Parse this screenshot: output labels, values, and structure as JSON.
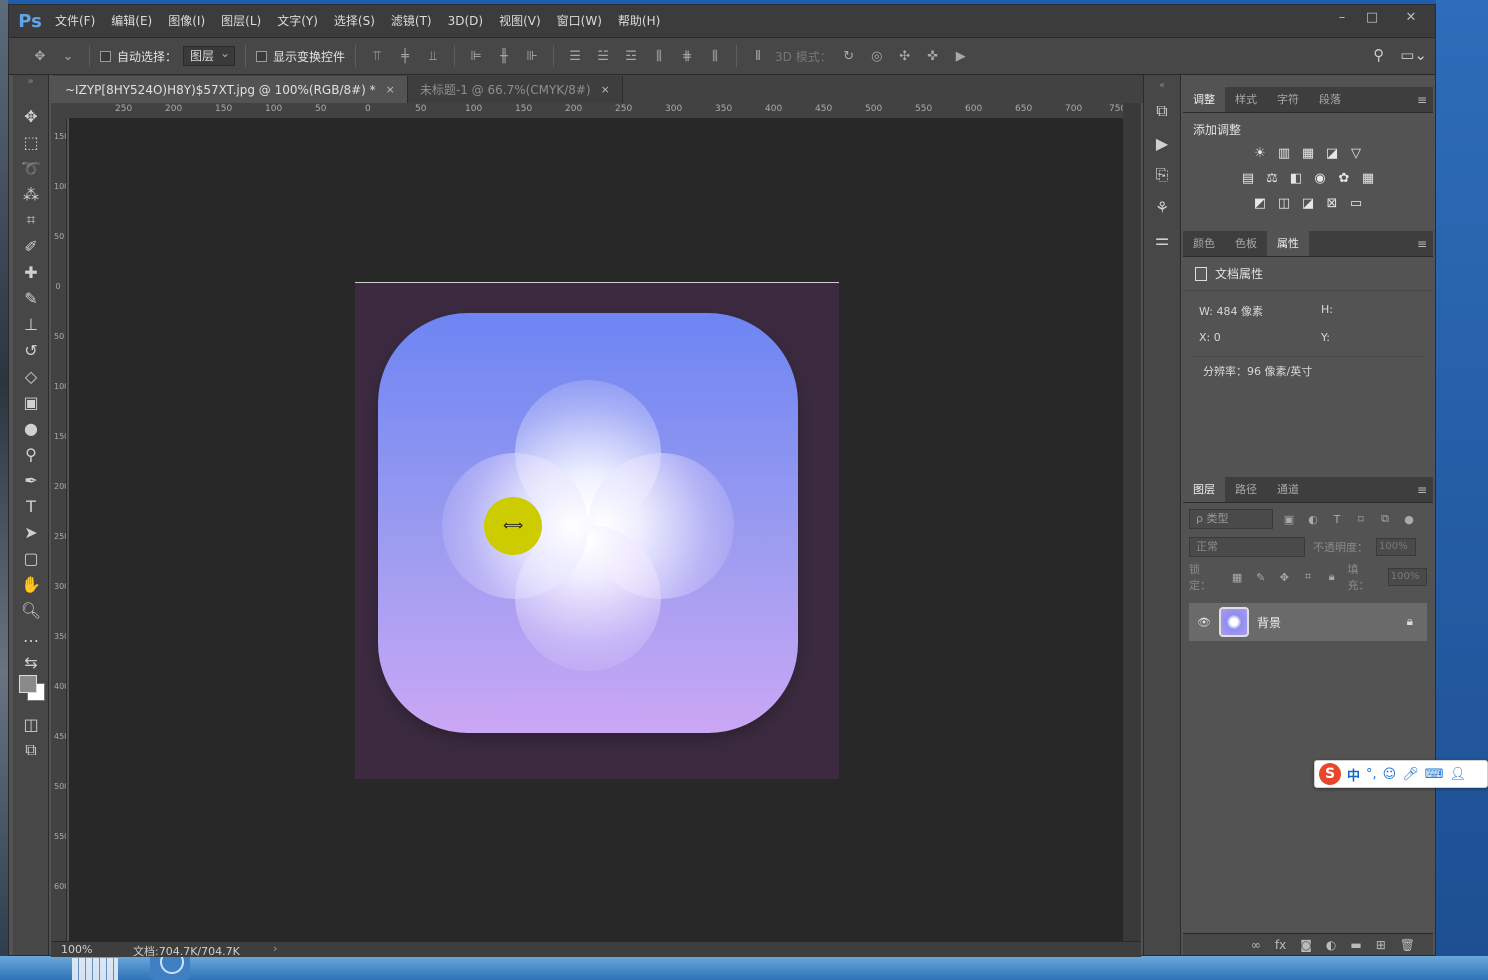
{
  "menubar": {
    "logo": "Ps",
    "items": [
      "文件(F)",
      "编辑(E)",
      "图像(I)",
      "图层(L)",
      "文字(Y)",
      "选择(S)",
      "滤镜(T)",
      "3D(D)",
      "视图(V)",
      "窗口(W)",
      "帮助(H)"
    ],
    "window_controls": [
      "–",
      "□",
      "✕"
    ]
  },
  "options": {
    "auto_select_label": "自动选择：",
    "auto_select_value": "图层",
    "show_transform_label": "显示变换控件",
    "mode_3d_label": "3D 模式："
  },
  "tabs": [
    {
      "label": "~IZYP[8HY524O)H8Y)$57XT.jpg @ 100%(RGB/8#) *",
      "close": "×"
    },
    {
      "label": "未标题-1 @ 66.7%(CMYK/8#)",
      "close": "×"
    }
  ],
  "ruler": {
    "top_labels": [
      "250",
      "200",
      "150",
      "100",
      "50",
      "0",
      "50",
      "100",
      "150",
      "200",
      "250",
      "300",
      "350",
      "400",
      "450",
      "500",
      "550",
      "600",
      "650",
      "700",
      "750"
    ],
    "left_labels": [
      "150",
      "100",
      "50",
      "0",
      "50",
      "100",
      "150",
      "200",
      "250",
      "300",
      "350",
      "400",
      "450",
      "500",
      "550",
      "600"
    ]
  },
  "cursor_glyph": "⟺",
  "status": {
    "zoom": "100%",
    "doc": "文档:704.7K/704.7K",
    "arrow": "›"
  },
  "adjust_panel": {
    "tabs": [
      "调整",
      "样式",
      "字符",
      "段落"
    ],
    "title": "添加调整",
    "icon_rows": [
      [
        "☀",
        "▥",
        "▦",
        "◪",
        "▽"
      ],
      [
        "▤",
        "⚖",
        "◧",
        "◉",
        "✿",
        "▦"
      ],
      [
        "◩",
        "◫",
        "◪",
        "⊠",
        "▭"
      ]
    ]
  },
  "props_panel": {
    "tabs": [
      "颜色",
      "色板",
      "属性"
    ],
    "header": "文档属性",
    "w_label": "W:",
    "w_value": "484 像素",
    "h_label": "H:",
    "x_label": "X:",
    "x_value": "0",
    "y_label": "Y:",
    "resolution": "分辨率：96 像素/英寸"
  },
  "layers_panel": {
    "tabs": [
      "图层",
      "路径",
      "通道"
    ],
    "filter_placeholder": "ρ 类型",
    "blend_mode": "正常",
    "opacity_label": "不透明度：",
    "opacity_value": "100%",
    "lock_label": "锁定：",
    "fill_label": "填充：",
    "fill_value": "100%",
    "layers": [
      {
        "name": "背景"
      }
    ]
  },
  "ime": {
    "logo": "S",
    "lang": "中",
    "punct": "°,"
  }
}
